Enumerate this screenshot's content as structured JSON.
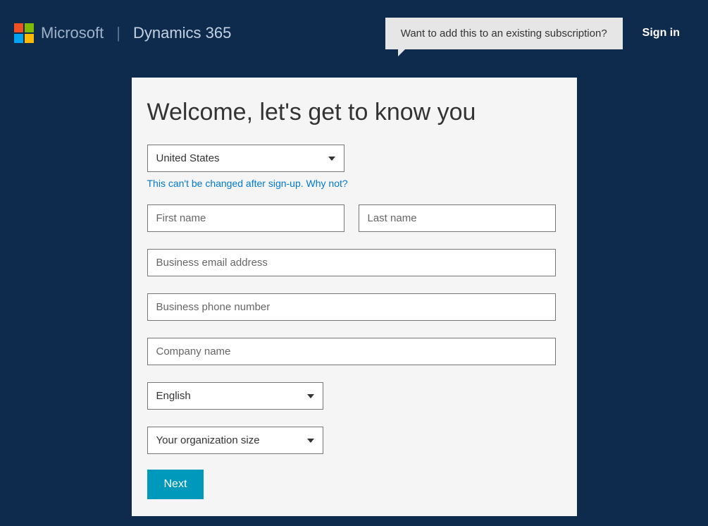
{
  "header": {
    "brand": "Microsoft",
    "product": "Dynamics 365",
    "tooltip": "Want to add this to an existing subscription?",
    "sign_in": "Sign in"
  },
  "form": {
    "title": "Welcome, let's get to know you",
    "country_selected": "United States",
    "country_hint": "This can't be changed after sign-up. Why not?",
    "first_name_placeholder": "First name",
    "last_name_placeholder": "Last name",
    "email_placeholder": "Business email address",
    "phone_placeholder": "Business phone number",
    "company_placeholder": "Company name",
    "language_selected": "English",
    "org_size_placeholder": "Your organization size",
    "next_label": "Next"
  }
}
